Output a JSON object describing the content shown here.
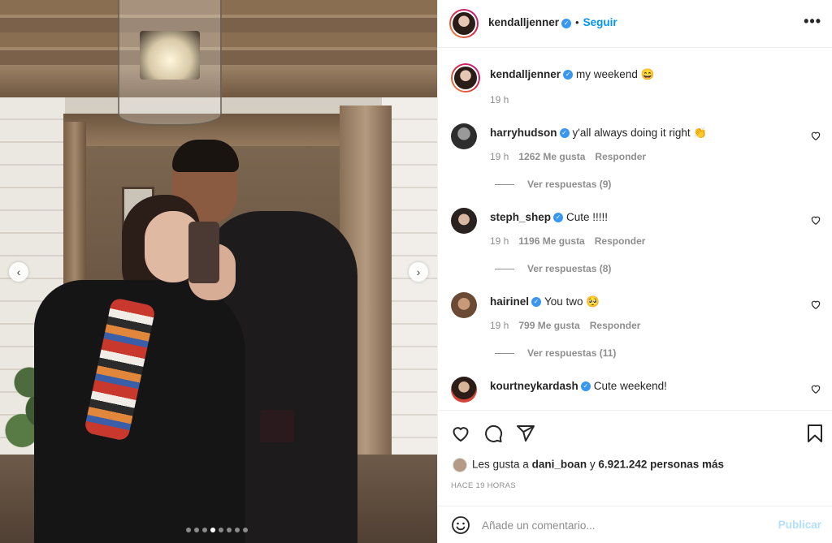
{
  "post": {
    "author": "kendalljenner",
    "follow_label": "Seguir",
    "more_label": "•••",
    "caption_user": "kendalljenner",
    "caption": "my weekend 😄",
    "caption_time": "19 h"
  },
  "carousel": {
    "prev_arrow": "‹",
    "next_arrow": "›",
    "slide_count": 8,
    "active_slide": 4
  },
  "comments": [
    {
      "user": "harryhudson",
      "text": "y'all always doing it right 👏",
      "time": "19 h",
      "likes": "1262 Me gusta",
      "reply": "Responder",
      "view_replies": "Ver respuestas (9)"
    },
    {
      "user": "steph_shep",
      "text": "Cute !!!!!",
      "time": "19 h",
      "likes": "1196 Me gusta",
      "reply": "Responder",
      "view_replies": "Ver respuestas (8)"
    },
    {
      "user": "hairinel",
      "text": "You two 🥺",
      "time": "19 h",
      "likes": "799 Me gusta",
      "reply": "Responder",
      "view_replies": "Ver respuestas (11)"
    },
    {
      "user": "kourtneykardash",
      "text": "Cute weekend!",
      "time": "",
      "likes": "",
      "reply": "",
      "view_replies": ""
    }
  ],
  "likes": {
    "prefix": "Les gusta a",
    "user": "dani_boan",
    "middle": "y",
    "count": "6.921.242 personas más"
  },
  "time_ago": "HACE 19 HORAS",
  "add_comment": {
    "placeholder": "Añade un comentario...",
    "publish_label": "Publicar"
  },
  "icons": {
    "verified": "✓",
    "like": "heart-icon",
    "comment": "comment-icon",
    "share": "share-icon",
    "save": "bookmark-icon",
    "emoji": "emoji-icon"
  },
  "colors": {
    "accent": "#0095f6",
    "verified": "#3897f0",
    "muted": "#8e8e8e",
    "publish_disabled": "#b2dffc"
  }
}
